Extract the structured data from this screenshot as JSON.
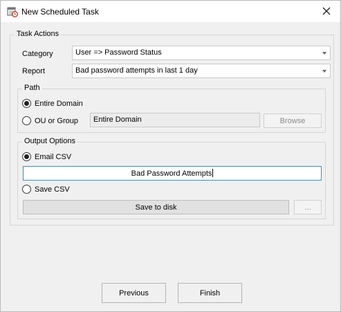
{
  "window": {
    "title": "New Scheduled Task"
  },
  "task_actions": {
    "legend": "Task Actions",
    "category_label": "Category",
    "category_value": "User => Password Status",
    "report_label": "Report",
    "report_value": "Bad password attempts in last 1 day"
  },
  "path": {
    "legend": "Path",
    "entire_domain_label": "Entire Domain",
    "entire_domain_checked": true,
    "ou_group_label": "OU or Group",
    "ou_group_checked": false,
    "ou_field_value": "Entire Domain",
    "browse_label": "Browse"
  },
  "output_options": {
    "legend": "Output Options",
    "email_csv_label": "Email CSV",
    "email_csv_checked": true,
    "email_subject_value": "Bad Password Attempts",
    "save_csv_label": "Save CSV",
    "save_csv_checked": false,
    "save_to_disk_label": "Save to disk",
    "ellipsis_label": "..."
  },
  "footer": {
    "previous_label": "Previous",
    "finish_label": "Finish"
  },
  "icons": {
    "title": "calendar-clock-icon",
    "close": "close-icon"
  }
}
